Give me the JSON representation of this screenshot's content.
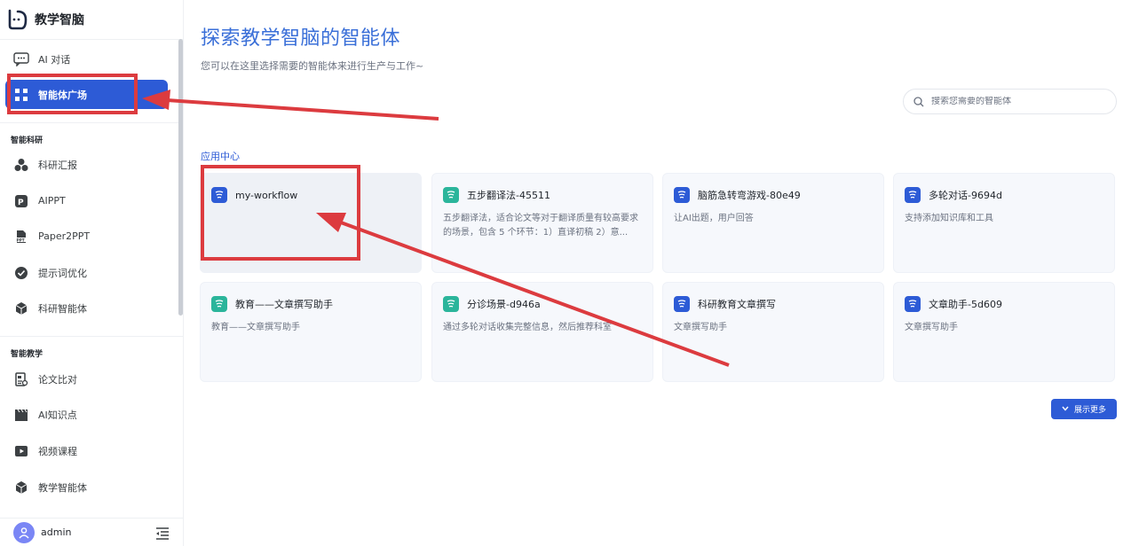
{
  "brand": {
    "name": "教学智脑"
  },
  "sidebar": {
    "items": [
      {
        "label": "AI 对话",
        "icon": "chat-icon"
      },
      {
        "label": "智能体广场",
        "icon": "grid-icon",
        "active": true
      }
    ],
    "sections": [
      {
        "title": "智能科研",
        "items": [
          {
            "label": "科研汇报",
            "icon": "report-icon"
          },
          {
            "label": "AIPPT",
            "icon": "ppt-icon"
          },
          {
            "label": "Paper2PPT",
            "icon": "paper-ppt-icon"
          },
          {
            "label": "提示词优化",
            "icon": "check-circle-icon"
          },
          {
            "label": "科研智能体",
            "icon": "cube-icon"
          }
        ]
      },
      {
        "title": "智能教学",
        "items": [
          {
            "label": "论文比对",
            "icon": "compare-icon"
          },
          {
            "label": "AI知识点",
            "icon": "clapper-icon"
          },
          {
            "label": "视频课程",
            "icon": "video-icon"
          },
          {
            "label": "教学智能体",
            "icon": "cube-icon"
          }
        ]
      }
    ]
  },
  "user": {
    "name": "admin"
  },
  "main": {
    "title": "探索教学智脑的智能体",
    "subtitle": "您可以在这里选择需要的智能体来进行生产与工作~",
    "search": {
      "placeholder": "搜索您需要的智能体",
      "value": ""
    },
    "section_label": "应用中心",
    "cards": [
      {
        "title": "my-workflow",
        "desc": "",
        "icon_color": "#2d5bd6"
      },
      {
        "title": "五步翻译法-45511",
        "desc": "五步翻译法，适合论文等对于翻译质量有较高要求的场景，包含 5 个环节：1）直译初稿 2）意...",
        "icon_color": "#2bb59b"
      },
      {
        "title": "脑筋急转弯游戏-80e49",
        "desc": "让AI出题，用户回答",
        "icon_color": "#2d5bd6"
      },
      {
        "title": "多轮对话-9694d",
        "desc": "支持添加知识库和工具",
        "icon_color": "#2d5bd6"
      },
      {
        "title": "教育——文章撰写助手",
        "desc": "教育——文章撰写助手",
        "icon_color": "#2bb59b"
      },
      {
        "title": "分诊场景-d946a",
        "desc": "通过多轮对话收集完整信息，然后推荐科室",
        "icon_color": "#2bb59b"
      },
      {
        "title": "科研教育文章撰写",
        "desc": "文章撰写助手",
        "icon_color": "#2d5bd6"
      },
      {
        "title": "文章助手-5d609",
        "desc": "文章撰写助手",
        "icon_color": "#2d5bd6"
      }
    ],
    "more_button": "展示更多"
  },
  "colors": {
    "accent": "#2d5bd6",
    "annotation": "#dc3b3f"
  }
}
